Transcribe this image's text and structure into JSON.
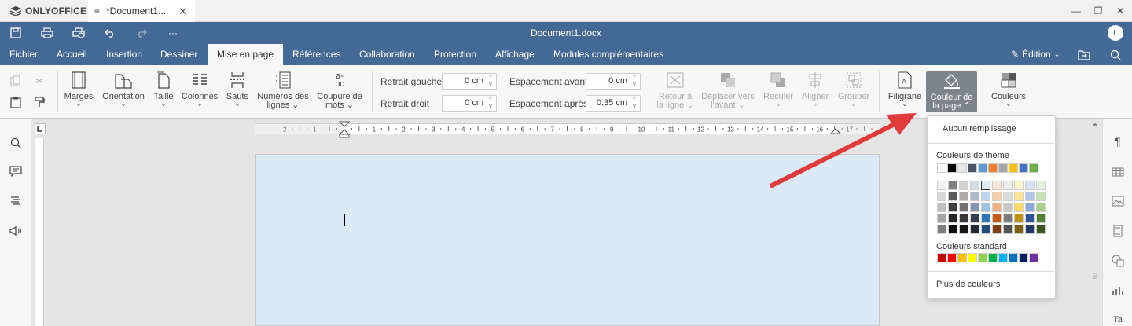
{
  "app": {
    "brand": "ONLYOFFICE",
    "tab_title": "*Document1....",
    "doc_title": "Document1.docx",
    "user_initial": "L"
  },
  "menu_tabs": [
    "Fichier",
    "Accueil",
    "Insertion",
    "Dessiner",
    "Mise en page",
    "Références",
    "Collaboration",
    "Protection",
    "Affichage",
    "Modules complémentaires"
  ],
  "edit_mode": "Édition",
  "toolbar": {
    "margins": "Marges",
    "orientation": "Orientation",
    "size": "Taille",
    "columns": "Colonnes",
    "breaks": "Sauts",
    "line_numbers_1": "Numéros des",
    "line_numbers_2": "lignes",
    "hyphenation_1": "Coupure de",
    "hyphenation_2": "mots",
    "indent_left_label": "Retrait gauche",
    "indent_left_value": "0 cm",
    "indent_right_label": "Retrait droit",
    "indent_right_value": "0 cm",
    "space_before_label": "Espacement avant",
    "space_before_value": "0 cm",
    "space_after_label": "Espacement après",
    "space_after_value": "0.35 cm",
    "wrap_1": "Retour à",
    "wrap_2": "la ligne",
    "forward_1": "Déplacer vers",
    "forward_2": "l'avant",
    "backward": "Reculer",
    "align": "Aligner",
    "group": "Grouper",
    "watermark": "Filigrane",
    "page_color_1": "Couleur de",
    "page_color_2": "la page",
    "colors": "Couleurs"
  },
  "ruler": {
    "h_labels": [
      "2",
      "1",
      "1",
      "2",
      "3",
      "4",
      "5",
      "6",
      "7",
      "8",
      "9",
      "10",
      "11",
      "12",
      "13",
      "14",
      "15",
      "16",
      "17"
    ]
  },
  "page_color_menu": {
    "no_fill": "Aucun remplissage",
    "theme_colors_label": "Couleurs de thème",
    "standard_colors_label": "Couleurs standard",
    "more_colors": "Plus de couleurs",
    "theme_top": [
      "#ffffff",
      "#000000",
      "#e7e6e6",
      "#44546a",
      "#5b9bd5",
      "#ed7d31",
      "#a5a5a5",
      "#ffc000",
      "#4472c4",
      "#70ad47"
    ],
    "theme_grid": [
      [
        "#f2f2f2",
        "#7f7f7f",
        "#d0cece",
        "#d6dce4",
        "#deebf6",
        "#fbe5d5",
        "#ededed",
        "#fff2cc",
        "#d9e2f3",
        "#e2efd9"
      ],
      [
        "#d8d8d8",
        "#595959",
        "#aeaaaa",
        "#adb9ca",
        "#bdd7ee",
        "#f8cbad",
        "#dbdbdb",
        "#ffe598",
        "#b4c6e7",
        "#c5e0b3"
      ],
      [
        "#bfbfbf",
        "#3f3f3f",
        "#757070",
        "#8496b0",
        "#9cc3e5",
        "#f4b183",
        "#c9c9c9",
        "#ffd965",
        "#8eaadb",
        "#a8d08d"
      ],
      [
        "#a5a5a5",
        "#262626",
        "#3a3838",
        "#323f4f",
        "#2e75b5",
        "#c55a11",
        "#7b7b7b",
        "#bf9000",
        "#2f5496",
        "#538135"
      ],
      [
        "#7f7f7f",
        "#0c0c0c",
        "#171616",
        "#222a35",
        "#1e4e79",
        "#833c0b",
        "#525252",
        "#7f6000",
        "#1f3864",
        "#375623"
      ]
    ],
    "standard": [
      "#c00000",
      "#ff0000",
      "#ffc000",
      "#ffff00",
      "#92d050",
      "#00b050",
      "#00b0f0",
      "#0070c0",
      "#002060",
      "#7030a0"
    ],
    "selected": "#deebf6"
  },
  "colors": {
    "header": "#446995",
    "page_bg": "#dce9f7",
    "arrow": "#e03a3a"
  }
}
